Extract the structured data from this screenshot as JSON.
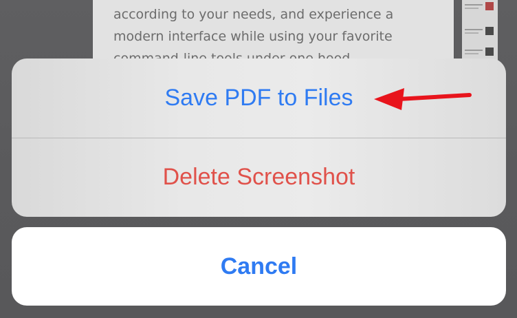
{
  "background_preview": {
    "lines": [
      "according to your needs, and experience a",
      "modern interface while using your favorite",
      "command-line tools under one hood"
    ]
  },
  "action_sheet": {
    "save_pdf_label": "Save PDF to Files",
    "delete_label": "Delete Screenshot",
    "cancel_label": "Cancel"
  },
  "colors": {
    "action_blue": "#2f7bf2",
    "destructive_red": "#e0514a",
    "annotation_red": "#e8141c"
  },
  "annotation": {
    "icon": "red-arrow-icon",
    "points_to": "Save PDF to Files"
  }
}
